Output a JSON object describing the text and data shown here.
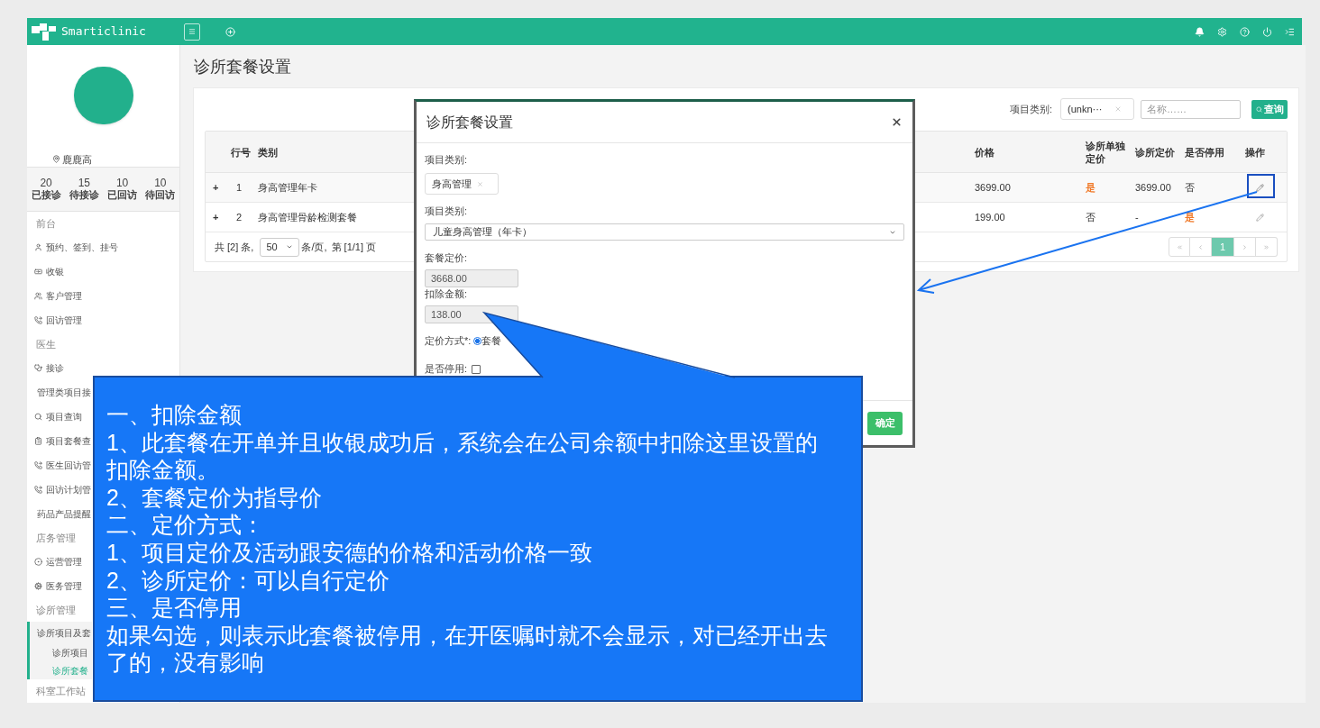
{
  "header": {
    "brand": "Smarticlinic"
  },
  "sidebar": {
    "location": "鹿鹿高",
    "stats": [
      {
        "value": "20",
        "label": "已接诊"
      },
      {
        "value": "15",
        "label": "待接诊"
      },
      {
        "value": "10",
        "label": "已回访"
      },
      {
        "value": "10",
        "label": "待回访"
      }
    ],
    "menu": [
      {
        "kind": "header",
        "label": "前台"
      },
      {
        "kind": "item",
        "label": "预约、签到、挂号",
        "selected": false
      },
      {
        "kind": "item",
        "label": "收银",
        "selected": false
      },
      {
        "kind": "item",
        "label": "客户管理",
        "selected": false
      },
      {
        "kind": "item",
        "label": "回访管理",
        "selected": false
      },
      {
        "kind": "header",
        "label": "医生"
      },
      {
        "kind": "item",
        "label": "接诊",
        "selected": false
      },
      {
        "kind": "subitem",
        "label": "管理类项目接",
        "selected": false
      },
      {
        "kind": "item",
        "label": "项目查询",
        "selected": false
      },
      {
        "kind": "item",
        "label": "项目套餐查",
        "selected": false
      },
      {
        "kind": "item",
        "label": "医生回访管",
        "selected": false
      },
      {
        "kind": "item",
        "label": "回访计划管",
        "selected": false
      },
      {
        "kind": "subitem",
        "label": "药品产品提醒",
        "selected": false
      },
      {
        "kind": "header",
        "label": "店务管理"
      },
      {
        "kind": "item",
        "label": "运营管理",
        "selected": false
      },
      {
        "kind": "item",
        "label": "医务管理",
        "selected": false
      },
      {
        "kind": "header",
        "label": "诊所管理"
      },
      {
        "kind": "group",
        "label": "诊所项目及套",
        "selected": true,
        "children": [
          {
            "label": "诊所项目",
            "selected": false
          },
          {
            "label": "诊所套餐",
            "selected": true
          }
        ]
      },
      {
        "kind": "header",
        "label": "科室工作站"
      }
    ]
  },
  "page": {
    "title": "诊所套餐设置",
    "filters": {
      "category_label": "项目类别:",
      "category_tag": "(unkn···",
      "name_placeholder": "名称……",
      "search_button": "查询"
    },
    "table": {
      "columns": [
        "行号",
        "类别",
        "价格",
        "诊所单独定价",
        "诊所定价",
        "是否停用",
        "操作"
      ],
      "rows": [
        {
          "expand": "+",
          "no": "1",
          "category": "身高管理年卡",
          "price": "3699.00",
          "own_price": {
            "text": "是",
            "highlighted": true
          },
          "clinic_price": "3699.00",
          "suspended": {
            "text": "否",
            "highlighted": false
          },
          "marked": true
        },
        {
          "expand": "+",
          "no": "2",
          "category": "身高管理骨龄检测套餐",
          "price": "199.00",
          "own_price": {
            "text": "否",
            "highlighted": false
          },
          "clinic_price": "-",
          "suspended": {
            "text": "是",
            "highlighted": true
          },
          "marked": false
        }
      ],
      "footer": {
        "total": "共 [2] 条,",
        "page_size": "50",
        "per_page": "条/页,",
        "page_info": "第 [1/1] 页"
      },
      "pages": [
        {
          "label": "1",
          "selected": true
        }
      ]
    }
  },
  "modal": {
    "title": "诊所套餐设置",
    "fields": [
      {
        "kind": "tag",
        "label": "项目类别:",
        "value": "身高管理"
      },
      {
        "kind": "select",
        "label": "项目类别:",
        "value": "儿童身高管理（年卡）"
      },
      {
        "kind": "readonly",
        "label": "套餐定价:",
        "value": "3668.00"
      },
      {
        "kind": "readonly",
        "label": "扣除金额:",
        "value": "138.00"
      },
      {
        "kind": "radio",
        "label": "定价方式*:",
        "options": [
          {
            "label": "套餐",
            "selected": true
          }
        ]
      },
      {
        "kind": "checkbox",
        "label": "是否停用:",
        "checked": false
      }
    ],
    "confirm": "确定"
  },
  "callout": {
    "lines": [
      "一、扣除金额",
      "1、此套餐在开单并且收银成功后，系统会在公司余额中扣除这里设置的扣除金额。",
      "2、套餐定价为指导价",
      "二、定价方式：",
      "1、项目定价及活动跟安德的价格和活动价格一致",
      "2、诊所定价：可以自行定价",
      "三、是否停用",
      "如果勾选，则表示此套餐被停用，在开医嘱时就不会显示，对已经开出去了的，没有影响"
    ]
  }
}
